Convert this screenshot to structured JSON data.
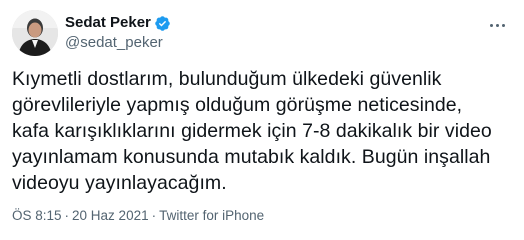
{
  "author": {
    "display_name": "Sedat Peker",
    "handle": "@sedat_peker",
    "verified": true,
    "avatar_icon": "profile-photo"
  },
  "tweet": {
    "text": "Kıymetli dostlarım, bulunduğum ülkedeki güvenlik\ngörevlileriyle yapmış olduğum görüşme neticesinde,\nkafa karışıklıklarını gidermek için 7-8 dakikalık bir video\nyayınlamam konusunda mutabık kaldık. Bugün inşallah\nvideoyu yayınlayacağım."
  },
  "meta": {
    "time": "ÖS 8:15",
    "separator": "·",
    "date": "20 Haz 2021",
    "separator2": "·",
    "source": "Twitter for iPhone"
  },
  "icons": {
    "verified": "verified-badge-icon",
    "more": "more-options-icon"
  },
  "colors": {
    "verified": "#1d9bf0",
    "text": "#0f1419",
    "secondary": "#536471"
  }
}
